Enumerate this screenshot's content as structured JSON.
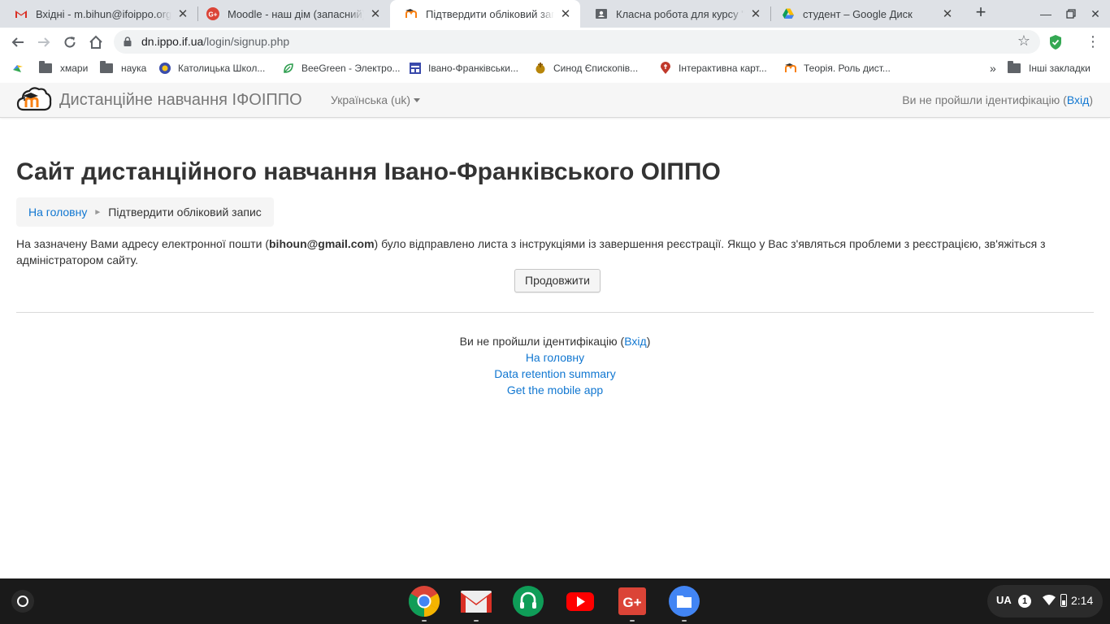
{
  "browser": {
    "tabs": [
      {
        "title": "Вхідні - m.bihun@ifoippo.org.ua",
        "icon": "gmail-icon",
        "active": false
      },
      {
        "title": "Moodle - наш дім (запасний) - Google+",
        "icon": "google-plus-icon",
        "active": false
      },
      {
        "title": "Підтвердити обліковий запис",
        "icon": "moodle-icon",
        "active": true
      },
      {
        "title": "Класна робота для курсу \"курс\"",
        "icon": "classroom-icon",
        "active": false
      },
      {
        "title": "студент – Google Диск",
        "icon": "google-drive-icon",
        "active": false
      }
    ],
    "new_tab_label": "+",
    "url": {
      "host": "dn.ippo.if.ua",
      "path": "/login/signup.php"
    }
  },
  "bookmarks": {
    "items": [
      {
        "label": "",
        "icon": "apps-icon"
      },
      {
        "label": "хмари",
        "icon": "folder-icon"
      },
      {
        "label": "наука",
        "icon": "folder-icon"
      },
      {
        "label": "Католицька Школ...",
        "icon": "school-icon"
      },
      {
        "label": "BeeGreen - Электро...",
        "icon": "leaf-icon"
      },
      {
        "label": "Івано-Франківськи...",
        "icon": "calendar-icon"
      },
      {
        "label": "Синод Єпископів...",
        "icon": "emblem-icon"
      },
      {
        "label": "Інтерактивна карт...",
        "icon": "map-pin-icon"
      },
      {
        "label": "Теорія. Роль дист...",
        "icon": "moodle-icon"
      }
    ],
    "overflow": "»",
    "other_bookmarks": "Інші закладки"
  },
  "moodle_navbar": {
    "site_name": "Дистанційне навчання ІФОІППО",
    "language": "Українська (uk)",
    "login_status_prefix": "Ви не пройшли ідентифікацію (",
    "login_link": "Вхід",
    "login_status_suffix": ")"
  },
  "page": {
    "heading": "Сайт дистанційного навчання Івано-Франківського ОІППО",
    "breadcrumb": {
      "home": "На головну",
      "current": "Підтвердити обліковий запис"
    },
    "notice": {
      "before": "На зазначену Вами адресу електронної пошти (",
      "email": "bihoun@gmail.com",
      "after": ") було відправлено листа з інструкціями із завершення реєстрації. Якщо у Вас з'являться проблеми з реєстрацією, зв'яжіться з адміністратором сайту."
    },
    "continue_button": "Продовжити"
  },
  "footer": {
    "login_prefix": "Ви не пройшли ідентифікацію (",
    "login_link": "Вхід",
    "login_suffix": ")",
    "home_link": "На головну",
    "data_retention_link": "Data retention summary",
    "mobile_app_link": "Get the mobile app"
  },
  "shelf": {
    "apps": [
      "chrome-icon",
      "gmail-icon",
      "hangouts-icon",
      "youtube-icon",
      "google-plus-icon",
      "files-icon"
    ],
    "ime": "UA",
    "notification_count": "1",
    "time": "2:14"
  },
  "colors": {
    "link": "#1177d1",
    "tabstrip": "#dee1e6",
    "shelf": "#1a1a1a"
  }
}
